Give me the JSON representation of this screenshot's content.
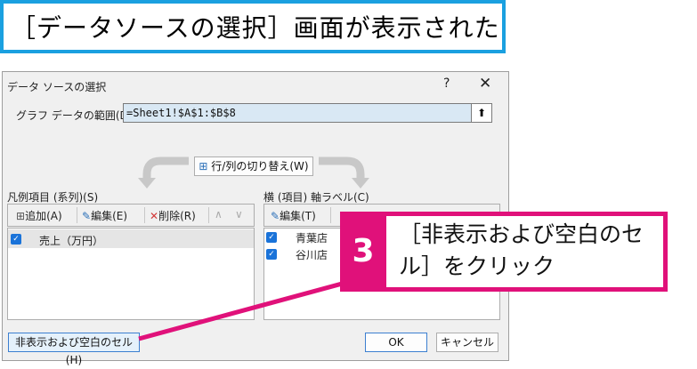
{
  "caption": "［データソースの選択］画面が表示された",
  "dialog": {
    "title": "データ ソースの選択",
    "help_icon": "?",
    "close_icon": "✕",
    "range_label": "グラフ データの範囲(D):",
    "range_value": "=Sheet1!$A$1:$B$8",
    "range_button_icon": "⬆",
    "switch_label": "行/列の切り替え(W)",
    "legend_label": "凡例項目 (系列)(S)",
    "axis_label": "横 (項目) 軸ラベル(C)",
    "legend_toolbar": {
      "add": "追加(A)",
      "edit": "編集(E)",
      "delete": "削除(R)",
      "up": "∧",
      "down": "∨"
    },
    "legend_items": [
      {
        "label": "売上（万円）",
        "checked": true
      }
    ],
    "axis_toolbar": {
      "edit": "編集(T)"
    },
    "axis_items": [
      {
        "label": "青葉店",
        "checked": true
      },
      {
        "label": "谷川店",
        "checked": true
      }
    ],
    "hidden_cells_button": "非表示および空白のセル(H)",
    "ok_button": "OK",
    "cancel_button": "キャンセル"
  },
  "callout": {
    "number": "3",
    "text": "［非表示および空白のセル］をクリック",
    "color": "#e0117a"
  },
  "colors": {
    "caption_border": "#1aa0e0",
    "selection": "#d9e8f4",
    "checkbox": "#1a73d9"
  }
}
